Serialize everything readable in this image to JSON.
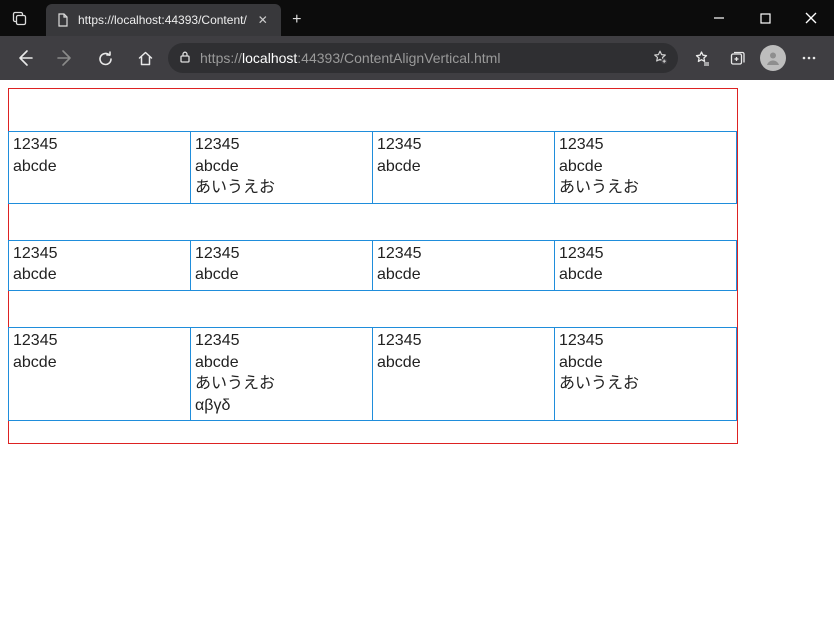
{
  "colors": {
    "outer_border": "#d22",
    "cell_border": "#1f8ddb"
  },
  "window": {
    "tab_title": "https://localhost:44393/Content/",
    "new_tab_label": "+"
  },
  "toolbar": {
    "url": {
      "proto": "https://",
      "host_strong": "localhost",
      "host_rest": ":44393",
      "path": "/ContentAlignVertical.html"
    }
  },
  "content": {
    "rows": [
      {
        "cells": [
          {
            "lines": [
              "12345",
              "abcde"
            ]
          },
          {
            "lines": [
              "12345",
              "abcde",
              "あいうえお"
            ]
          },
          {
            "lines": [
              "12345",
              "abcde"
            ]
          },
          {
            "lines": [
              "12345",
              "abcde",
              "あいうえお"
            ]
          }
        ]
      },
      {
        "cells": [
          {
            "lines": [
              "12345",
              "abcde"
            ]
          },
          {
            "lines": [
              "12345",
              "abcde"
            ]
          },
          {
            "lines": [
              "12345",
              "abcde"
            ]
          },
          {
            "lines": [
              "12345",
              "abcde"
            ]
          }
        ]
      },
      {
        "cells": [
          {
            "lines": [
              "12345",
              "abcde"
            ]
          },
          {
            "lines": [
              "12345",
              "abcde",
              "あいうえお",
              "αβγδ"
            ]
          },
          {
            "lines": [
              "12345",
              "abcde"
            ]
          },
          {
            "lines": [
              "12345",
              "abcde",
              "あいうえお"
            ]
          }
        ]
      }
    ]
  }
}
